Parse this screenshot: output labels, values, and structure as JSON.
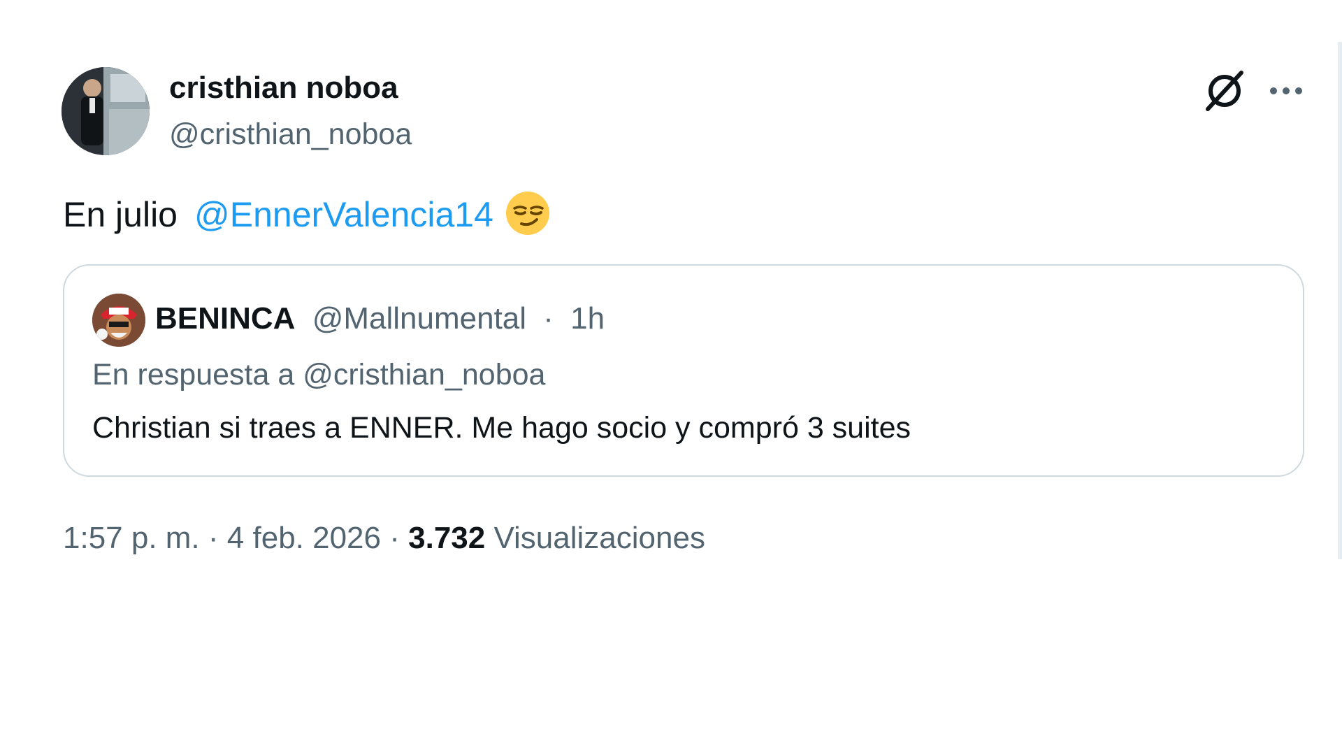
{
  "author": {
    "name": "cristhian noboa",
    "handle": "@cristhian_noboa"
  },
  "icons": {
    "grok": "grok-icon",
    "more": "more-icon",
    "emoji": "smirking-face-emoji"
  },
  "tweet": {
    "text": "En julio",
    "mention": "@EnnerValencia14",
    "emoji": "😏"
  },
  "quote": {
    "name": "BENINCA",
    "handle": "@Mallnumental",
    "separator": "·",
    "time": "1h",
    "reply_to": "En respuesta a @cristhian_noboa",
    "text": "Christian si traes a ENNER. Me hago socio y compró 3 suites"
  },
  "footer": {
    "time": "1:57 p. m.",
    "separator": "·",
    "date": "4 feb. 2026",
    "views_count": "3.732",
    "views_label": "Visualizaciones"
  },
  "colors": {
    "link": "#1d9bf0",
    "secondary_text": "#536471",
    "primary_text": "#0f1419",
    "border": "#cfd9de"
  }
}
